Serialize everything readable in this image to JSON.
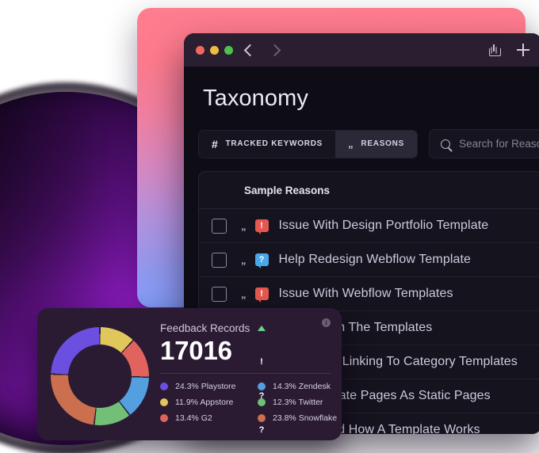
{
  "window": {
    "titlebar": {
      "lights": [
        "close",
        "minimize",
        "zoom"
      ],
      "back_icon": "chevron-left-icon",
      "forward_icon": "chevron-right-icon",
      "share_icon": "share-icon",
      "add_icon": "plus-icon"
    },
    "page_title": "Taxonomy",
    "tabs": [
      {
        "label": "TRACKED KEYWORDS",
        "icon": "hash-icon",
        "glyph": "#",
        "active": false
      },
      {
        "label": "REASONS",
        "icon": "quote-icon",
        "glyph": "\"\"",
        "active": true
      }
    ],
    "search": {
      "icon": "search-icon",
      "placeholder": "Search for Reasons",
      "value": ""
    },
    "table": {
      "header": "Sample Reasons",
      "rows": [
        {
          "checked": false,
          "quote": "\"\"",
          "badge": "alert",
          "badge_glyph": "!",
          "text": "Issue With Design Portfolio Template"
        },
        {
          "checked": false,
          "quote": "\"\"",
          "badge": "help",
          "badge_glyph": "?",
          "text": "Help Redesign Webflow Template"
        },
        {
          "checked": false,
          "quote": "\"\"",
          "badge": "alert",
          "badge_glyph": "!",
          "text": "Issue With Webflow Templates"
        },
        {
          "checked": false,
          "quote": "\"\"",
          "badge": "happy",
          "badge_glyph": "",
          "text": "Happy With The Templates"
        },
        {
          "checked": false,
          "quote": "\"\"",
          "badge": "alert",
          "badge_glyph": "!",
          "text": "Issue With Linking To Category Templates"
        },
        {
          "checked": false,
          "quote": "\"\"",
          "badge": "help",
          "badge_glyph": "?",
          "text": "Use Template Pages As Static Pages"
        },
        {
          "checked": false,
          "quote": "\"\"",
          "badge": "help",
          "badge_glyph": "?",
          "text": "Understand How A Template Works"
        }
      ]
    }
  },
  "feedback_card": {
    "title": "Feedback Records",
    "value": "17016",
    "info_icon": "info-icon",
    "info_glyph": "i"
  },
  "chart_data": {
    "type": "pie",
    "title": "Feedback Records",
    "total": 17016,
    "donut": true,
    "legend_position": "right",
    "categories": [
      "Appstore",
      "G2",
      "Zendesk",
      "Twitter",
      "Snowflake",
      "Playstore"
    ],
    "values": [
      11.9,
      13.4,
      14.3,
      12.3,
      23.8,
      24.3
    ],
    "colors": [
      "#e0c75c",
      "#e0645d",
      "#539fe0",
      "#72bf77",
      "#cb6f4f",
      "#6b4fe0"
    ],
    "slices": [
      {
        "label": "Playstore",
        "value": 24.3,
        "display": "24.3% Playstore",
        "color": "#6b4fe0"
      },
      {
        "label": "Appstore",
        "value": 11.9,
        "display": "11.9% Appstore",
        "color": "#e0c75c"
      },
      {
        "label": "G2",
        "value": 13.4,
        "display": "13.4% G2",
        "color": "#e0645d"
      },
      {
        "label": "Zendesk",
        "value": 14.3,
        "display": "14.3% Zendesk",
        "color": "#539fe0"
      },
      {
        "label": "Twitter",
        "value": 12.3,
        "display": "12.3% Twitter",
        "color": "#72bf77"
      },
      {
        "label": "Snowflake",
        "value": 23.8,
        "display": "23.8% Snowflake",
        "color": "#cb6f4f"
      }
    ],
    "legend_order": [
      [
        "Playstore",
        "Zendesk"
      ],
      [
        "Appstore",
        "Twitter"
      ],
      [
        "G2",
        "Snowflake"
      ]
    ]
  },
  "decor": {
    "sphere_color": "#7d17ad",
    "gradient_card_from": "#fe7d8f",
    "gradient_card_to": "#7f9dfb"
  }
}
